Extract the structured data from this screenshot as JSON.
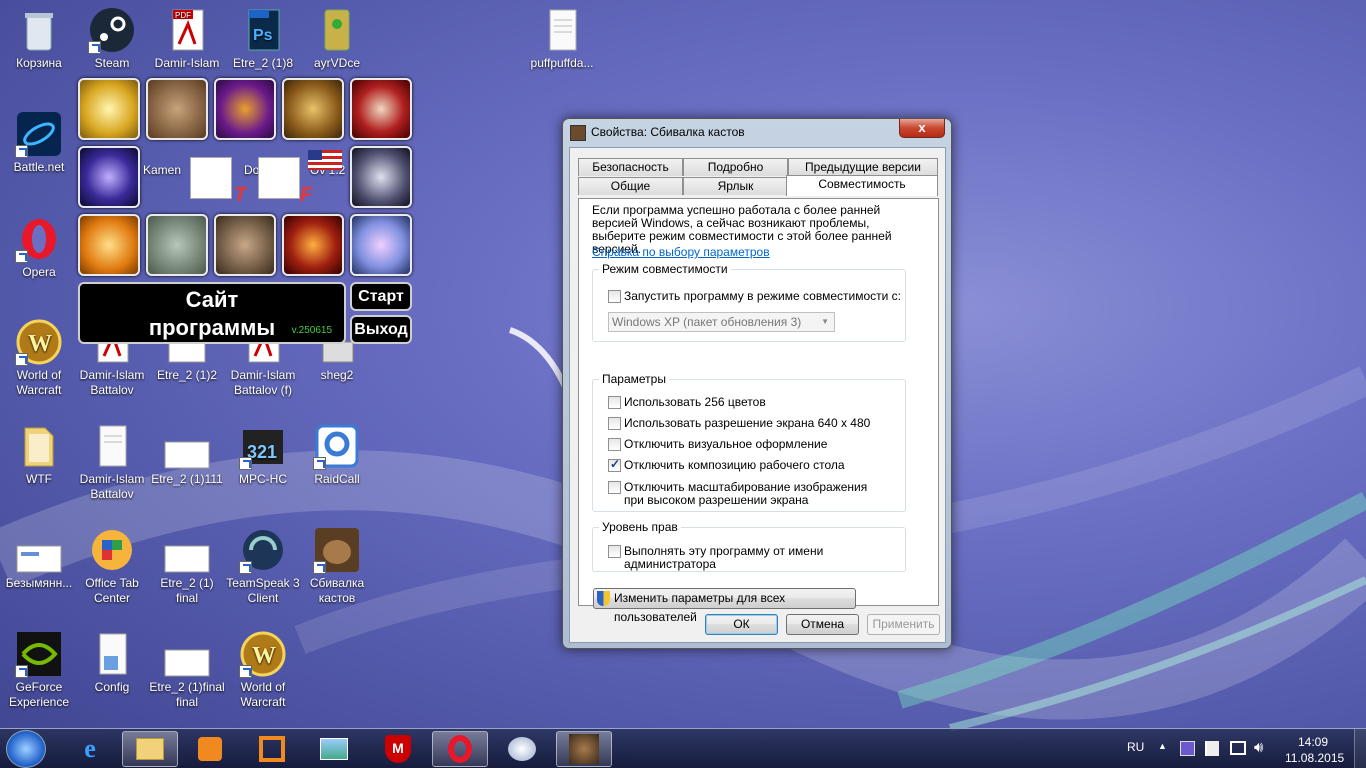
{
  "desktop": {
    "icons": [
      {
        "label": "Корзина",
        "x": 0,
        "y": 0
      },
      {
        "label": "Steam"
      },
      {
        "label": "Damir-Islam"
      },
      {
        "label": "Etre_2 (1)8"
      },
      {
        "label": "ayrVDce"
      },
      {
        "label": "puffpuffda..."
      },
      {
        "label": "Battle.net"
      },
      {
        "label": "Opera"
      },
      {
        "label": "World of Warcraft"
      },
      {
        "label": "Damir-Islam Battalov"
      },
      {
        "label": "Etre_2 (1)2"
      },
      {
        "label": "Damir-Islam Battalov (f)"
      },
      {
        "label": "sheg2"
      },
      {
        "label": "WTF"
      },
      {
        "label": "Damir-Islam Battalov"
      },
      {
        "label": "Etre_2 (1)111"
      },
      {
        "label": "MPC-HC"
      },
      {
        "label": "RaidCall"
      },
      {
        "label": "Безымянн..."
      },
      {
        "label": "Office Tab Center"
      },
      {
        "label": "Etre_2 (1) final"
      },
      {
        "label": "TeamSpeak 3 Client"
      },
      {
        "label": "Сбивалка кастов"
      },
      {
        "label": "GeForce Experience"
      },
      {
        "label": "Config"
      },
      {
        "label": "Etre_2 (1)final final"
      },
      {
        "label": "World of Warcraft"
      }
    ],
    "partial_labels": [
      "Kamen",
      "Do",
      "Ov 1.2"
    ]
  },
  "launcher": {
    "site_label": "Сайт программы",
    "version": "v.250615",
    "start_label": "Старт",
    "exit_label": "Выход",
    "letter_t": "T",
    "letter_f": "F"
  },
  "dialog": {
    "title": "Свойства: Сбивалка кастов",
    "close": "x",
    "tabs_row1": [
      "Безопасность",
      "Подробно",
      "Предыдущие версии"
    ],
    "tabs_row2": [
      "Общие",
      "Ярлык",
      "Совместимость"
    ],
    "intro": "Если программа успешно работала с более ранней версией Windows, а сейчас возникают проблемы, выберите режим совместимости с этой более ранней версией.",
    "help_link": "Справка по выбору параметров",
    "compat_group": "Режим совместимости",
    "compat_check": "Запустить программу в режиме совместимости с:",
    "compat_select": "Windows XP (пакет обновления 3)",
    "params_group": "Параметры",
    "params": [
      {
        "label": "Использовать 256 цветов",
        "checked": false
      },
      {
        "label": "Использовать разрешение экрана 640 х 480",
        "checked": false
      },
      {
        "label": "Отключить визуальное оформление",
        "checked": false
      },
      {
        "label": "Отключить композицию рабочего стола",
        "checked": true
      },
      {
        "label": "Отключить масштабирование изображения при высоком разрешении экрана",
        "checked": false
      }
    ],
    "rights_group": "Уровень прав",
    "admin_check": "Выполнять эту программу от имени администратора",
    "all_users_btn": "Изменить параметры для всех пользователей",
    "ok": "ОК",
    "cancel": "Отмена",
    "apply": "Применить"
  },
  "taskbar": {
    "lang": "RU",
    "time": "14:09",
    "date": "11.08.2015"
  }
}
